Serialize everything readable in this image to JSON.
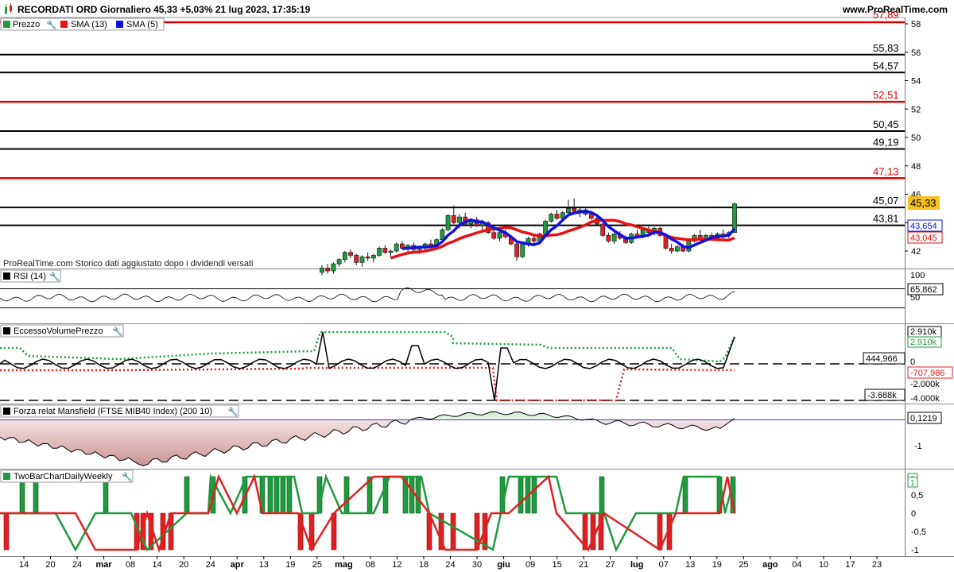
{
  "header": {
    "title": "RECORDATI ORD Giornaliero 45,33 +5,03% 21 lug 2023, 17:35:19",
    "site": "www.ProRealTime.com"
  },
  "panels": {
    "price": {
      "legend": [
        "Prezzo",
        "SMA (13)",
        "SMA (5)"
      ],
      "watermark": "ProRealTime.com  Storico dati aggiustato dopo i dividendi versati",
      "y_ticks": [
        "58",
        "56",
        "54",
        "52",
        "50",
        "48",
        "46",
        "44",
        "42"
      ],
      "current_price": "45,33",
      "sma5_value": "43,654",
      "sma13_value": "43,045",
      "top_line_label": "57,89",
      "horizontal_lines": [
        {
          "label": "55,83",
          "value": 55.83,
          "color": "#000000"
        },
        {
          "label": "54,57",
          "value": 54.57,
          "color": "#000000"
        },
        {
          "label": "52,51",
          "value": 52.51,
          "color": "#e00000"
        },
        {
          "label": "50,45",
          "value": 50.45,
          "color": "#000000"
        },
        {
          "label": "49,19",
          "value": 49.19,
          "color": "#000000"
        },
        {
          "label": "47,13",
          "value": 47.13,
          "color": "#e00000"
        },
        {
          "label": "45,07",
          "value": 45.07,
          "color": "#000000"
        },
        {
          "label": "43,81",
          "value": 43.81,
          "color": "#000000"
        }
      ]
    },
    "rsi": {
      "label": "RSI (14)",
      "y_ticks": [
        "100",
        "50"
      ],
      "value": "65,862"
    },
    "volume": {
      "label": "EccessoVolumePrezzo",
      "values": [
        "2.910k",
        "2.910k",
        "444,966",
        "-707,986",
        "-3.688k"
      ],
      "y_ticks": [
        "0",
        "-2.000k",
        "-4.000k"
      ]
    },
    "mansfield": {
      "label": "Forza relat Mansfield (FTSE MIB40 Index) (200 10)",
      "value": "0,1219",
      "y_ticks": [
        "-1"
      ]
    },
    "twobar": {
      "label": "TwoBarChartDailyWeekly",
      "values": [
        "1",
        "1"
      ],
      "y_ticks": [
        "1",
        "0,5",
        "0",
        "-0,5",
        "-1"
      ]
    }
  },
  "x_axis": {
    "labels": [
      "14",
      "20",
      "24",
      "mar",
      "08",
      "14",
      "20",
      "24",
      "apr",
      "13",
      "19",
      "25",
      "mag",
      "08",
      "12",
      "18",
      "24",
      "30",
      "giu",
      "09",
      "15",
      "21",
      "27",
      "lug",
      "07",
      "13",
      "19",
      "25",
      "ago",
      "04",
      "10",
      "17",
      "23"
    ],
    "bold_labels": [
      "mar",
      "apr",
      "mag",
      "giu",
      "lug",
      "ago"
    ]
  },
  "colors": {
    "up": "#1f9a3c",
    "down": "#e02020",
    "sma13": "#e81010",
    "sma5": "#1010e0",
    "price_tag_bg": "#f7c21b",
    "mansfield_fill": "#d9aaaa"
  },
  "chart_data": {
    "type": "candlestick",
    "title": "RECORDATI ORD Giornaliero",
    "series": [
      {
        "name": "SMA (13)",
        "last": 43.045
      },
      {
        "name": "SMA (5)",
        "last": 43.654
      }
    ],
    "price_candles": [
      [
        40.5,
        41.0,
        40.3,
        40.8
      ],
      [
        40.8,
        41.1,
        40.4,
        40.6
      ],
      [
        40.6,
        41.2,
        40.4,
        41.1
      ],
      [
        41.1,
        41.5,
        40.9,
        41.4
      ],
      [
        41.4,
        42.0,
        41.2,
        41.9
      ],
      [
        41.9,
        42.1,
        41.5,
        41.7
      ],
      [
        41.7,
        41.8,
        41.0,
        41.2
      ],
      [
        41.2,
        41.7,
        40.9,
        41.6
      ],
      [
        41.6,
        41.9,
        41.3,
        41.5
      ],
      [
        41.5,
        41.8,
        41.2,
        41.7
      ],
      [
        41.7,
        42.3,
        41.6,
        42.2
      ],
      [
        42.2,
        42.4,
        41.8,
        41.9
      ],
      [
        41.9,
        42.1,
        41.5,
        42.0
      ],
      [
        42.0,
        42.6,
        41.9,
        42.5
      ],
      [
        42.5,
        42.7,
        42.1,
        42.2
      ],
      [
        42.2,
        42.5,
        41.9,
        42.4
      ],
      [
        42.4,
        42.6,
        42.0,
        42.1
      ],
      [
        42.1,
        42.3,
        41.8,
        42.2
      ],
      [
        42.2,
        42.6,
        42.0,
        42.5
      ],
      [
        42.5,
        42.8,
        42.2,
        42.3
      ],
      [
        42.3,
        42.9,
        42.2,
        42.8
      ],
      [
        42.8,
        43.6,
        42.7,
        43.5
      ],
      [
        43.5,
        44.6,
        43.4,
        44.5
      ],
      [
        44.5,
        45.2,
        43.9,
        44.0
      ],
      [
        44.0,
        44.6,
        43.6,
        44.4
      ],
      [
        44.4,
        44.7,
        43.8,
        43.9
      ],
      [
        43.9,
        44.3,
        43.6,
        44.2
      ],
      [
        44.2,
        44.4,
        43.7,
        43.8
      ],
      [
        43.8,
        44.2,
        43.5,
        44.0
      ],
      [
        44.0,
        44.1,
        43.2,
        43.3
      ],
      [
        43.3,
        43.6,
        42.8,
        42.9
      ],
      [
        42.9,
        43.4,
        42.7,
        43.3
      ],
      [
        43.3,
        43.5,
        42.9,
        43.0
      ],
      [
        43.0,
        43.1,
        42.4,
        42.5
      ],
      [
        42.5,
        42.6,
        41.3,
        41.6
      ],
      [
        41.6,
        42.6,
        41.5,
        42.5
      ],
      [
        42.5,
        43.0,
        42.3,
        42.9
      ],
      [
        42.9,
        43.1,
        42.5,
        42.7
      ],
      [
        42.7,
        43.3,
        42.6,
        43.2
      ],
      [
        43.2,
        44.2,
        43.1,
        44.1
      ],
      [
        44.1,
        44.7,
        44.0,
        44.6
      ],
      [
        44.6,
        44.9,
        44.2,
        44.3
      ],
      [
        44.3,
        44.8,
        44.1,
        44.7
      ],
      [
        44.7,
        45.6,
        44.6,
        45.0
      ],
      [
        45.0,
        45.7,
        44.7,
        44.8
      ],
      [
        44.8,
        45.1,
        44.4,
        44.9
      ],
      [
        44.9,
        45.0,
        44.5,
        44.6
      ],
      [
        44.6,
        44.8,
        44.2,
        44.3
      ],
      [
        44.3,
        44.4,
        43.8,
        43.9
      ],
      [
        43.9,
        44.0,
        43.0,
        43.1
      ],
      [
        43.1,
        43.3,
        42.6,
        42.7
      ],
      [
        42.7,
        43.3,
        42.5,
        43.2
      ],
      [
        43.2,
        43.4,
        42.8,
        42.9
      ],
      [
        42.9,
        43.1,
        42.5,
        42.6
      ],
      [
        42.6,
        43.3,
        42.5,
        43.2
      ],
      [
        43.2,
        43.5,
        42.9,
        43.0
      ],
      [
        43.0,
        43.6,
        42.9,
        43.5
      ],
      [
        43.5,
        43.8,
        43.2,
        43.3
      ],
      [
        43.3,
        43.7,
        43.1,
        43.6
      ],
      [
        43.6,
        43.7,
        43.0,
        43.1
      ],
      [
        43.1,
        43.2,
        42.1,
        42.2
      ],
      [
        42.2,
        42.5,
        41.8,
        42.0
      ],
      [
        42.0,
        42.4,
        41.9,
        42.3
      ],
      [
        42.3,
        42.5,
        41.9,
        42.0
      ],
      [
        42.0,
        42.8,
        41.9,
        42.7
      ],
      [
        42.7,
        43.2,
        42.6,
        43.1
      ],
      [
        43.1,
        43.5,
        42.8,
        42.9
      ],
      [
        42.9,
        43.2,
        42.8,
        43.1
      ],
      [
        43.1,
        43.3,
        42.8,
        42.9
      ],
      [
        42.9,
        43.3,
        42.8,
        43.2
      ],
      [
        43.2,
        43.5,
        42.9,
        43.1
      ],
      [
        43.1,
        43.4,
        42.9,
        43.3
      ],
      [
        43.3,
        45.4,
        43.3,
        45.33
      ]
    ]
  }
}
